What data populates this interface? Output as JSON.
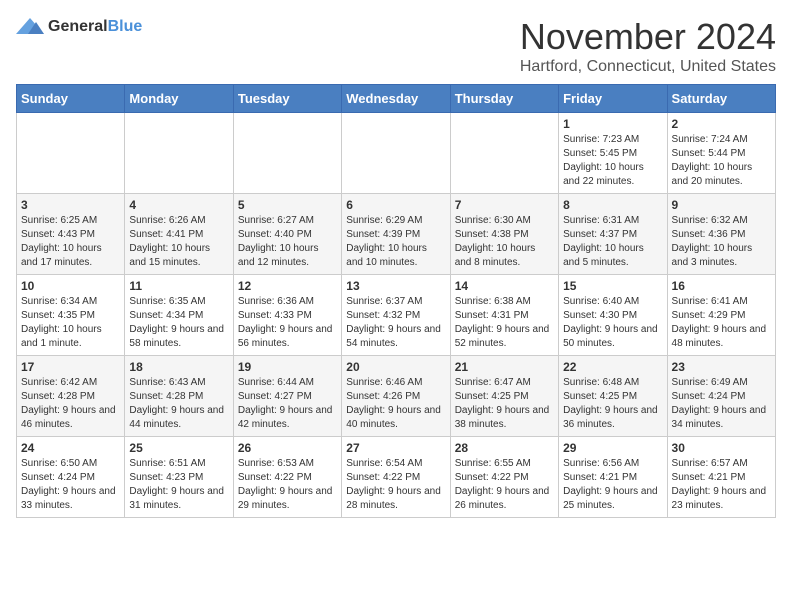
{
  "logo": {
    "general": "General",
    "blue": "Blue"
  },
  "title": "November 2024",
  "location": "Hartford, Connecticut, United States",
  "days_header": [
    "Sunday",
    "Monday",
    "Tuesday",
    "Wednesday",
    "Thursday",
    "Friday",
    "Saturday"
  ],
  "weeks": [
    [
      {
        "day": "",
        "info": ""
      },
      {
        "day": "",
        "info": ""
      },
      {
        "day": "",
        "info": ""
      },
      {
        "day": "",
        "info": ""
      },
      {
        "day": "",
        "info": ""
      },
      {
        "day": "1",
        "info": "Sunrise: 7:23 AM\nSunset: 5:45 PM\nDaylight: 10 hours and 22 minutes."
      },
      {
        "day": "2",
        "info": "Sunrise: 7:24 AM\nSunset: 5:44 PM\nDaylight: 10 hours and 20 minutes."
      }
    ],
    [
      {
        "day": "3",
        "info": "Sunrise: 6:25 AM\nSunset: 4:43 PM\nDaylight: 10 hours and 17 minutes."
      },
      {
        "day": "4",
        "info": "Sunrise: 6:26 AM\nSunset: 4:41 PM\nDaylight: 10 hours and 15 minutes."
      },
      {
        "day": "5",
        "info": "Sunrise: 6:27 AM\nSunset: 4:40 PM\nDaylight: 10 hours and 12 minutes."
      },
      {
        "day": "6",
        "info": "Sunrise: 6:29 AM\nSunset: 4:39 PM\nDaylight: 10 hours and 10 minutes."
      },
      {
        "day": "7",
        "info": "Sunrise: 6:30 AM\nSunset: 4:38 PM\nDaylight: 10 hours and 8 minutes."
      },
      {
        "day": "8",
        "info": "Sunrise: 6:31 AM\nSunset: 4:37 PM\nDaylight: 10 hours and 5 minutes."
      },
      {
        "day": "9",
        "info": "Sunrise: 6:32 AM\nSunset: 4:36 PM\nDaylight: 10 hours and 3 minutes."
      }
    ],
    [
      {
        "day": "10",
        "info": "Sunrise: 6:34 AM\nSunset: 4:35 PM\nDaylight: 10 hours and 1 minute."
      },
      {
        "day": "11",
        "info": "Sunrise: 6:35 AM\nSunset: 4:34 PM\nDaylight: 9 hours and 58 minutes."
      },
      {
        "day": "12",
        "info": "Sunrise: 6:36 AM\nSunset: 4:33 PM\nDaylight: 9 hours and 56 minutes."
      },
      {
        "day": "13",
        "info": "Sunrise: 6:37 AM\nSunset: 4:32 PM\nDaylight: 9 hours and 54 minutes."
      },
      {
        "day": "14",
        "info": "Sunrise: 6:38 AM\nSunset: 4:31 PM\nDaylight: 9 hours and 52 minutes."
      },
      {
        "day": "15",
        "info": "Sunrise: 6:40 AM\nSunset: 4:30 PM\nDaylight: 9 hours and 50 minutes."
      },
      {
        "day": "16",
        "info": "Sunrise: 6:41 AM\nSunset: 4:29 PM\nDaylight: 9 hours and 48 minutes."
      }
    ],
    [
      {
        "day": "17",
        "info": "Sunrise: 6:42 AM\nSunset: 4:28 PM\nDaylight: 9 hours and 46 minutes."
      },
      {
        "day": "18",
        "info": "Sunrise: 6:43 AM\nSunset: 4:28 PM\nDaylight: 9 hours and 44 minutes."
      },
      {
        "day": "19",
        "info": "Sunrise: 6:44 AM\nSunset: 4:27 PM\nDaylight: 9 hours and 42 minutes."
      },
      {
        "day": "20",
        "info": "Sunrise: 6:46 AM\nSunset: 4:26 PM\nDaylight: 9 hours and 40 minutes."
      },
      {
        "day": "21",
        "info": "Sunrise: 6:47 AM\nSunset: 4:25 PM\nDaylight: 9 hours and 38 minutes."
      },
      {
        "day": "22",
        "info": "Sunrise: 6:48 AM\nSunset: 4:25 PM\nDaylight: 9 hours and 36 minutes."
      },
      {
        "day": "23",
        "info": "Sunrise: 6:49 AM\nSunset: 4:24 PM\nDaylight: 9 hours and 34 minutes."
      }
    ],
    [
      {
        "day": "24",
        "info": "Sunrise: 6:50 AM\nSunset: 4:24 PM\nDaylight: 9 hours and 33 minutes."
      },
      {
        "day": "25",
        "info": "Sunrise: 6:51 AM\nSunset: 4:23 PM\nDaylight: 9 hours and 31 minutes."
      },
      {
        "day": "26",
        "info": "Sunrise: 6:53 AM\nSunset: 4:22 PM\nDaylight: 9 hours and 29 minutes."
      },
      {
        "day": "27",
        "info": "Sunrise: 6:54 AM\nSunset: 4:22 PM\nDaylight: 9 hours and 28 minutes."
      },
      {
        "day": "28",
        "info": "Sunrise: 6:55 AM\nSunset: 4:22 PM\nDaylight: 9 hours and 26 minutes."
      },
      {
        "day": "29",
        "info": "Sunrise: 6:56 AM\nSunset: 4:21 PM\nDaylight: 9 hours and 25 minutes."
      },
      {
        "day": "30",
        "info": "Sunrise: 6:57 AM\nSunset: 4:21 PM\nDaylight: 9 hours and 23 minutes."
      }
    ]
  ]
}
